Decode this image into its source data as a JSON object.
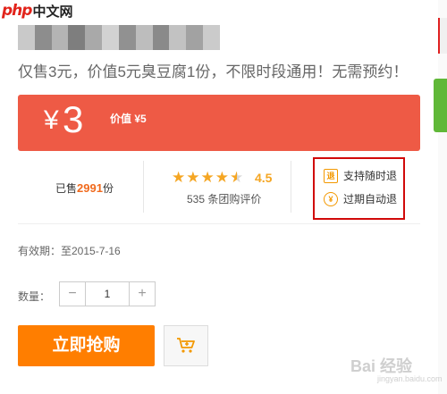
{
  "site_logo": {
    "php": "php",
    "cn": "中文网"
  },
  "deal": {
    "subtitle": "仅售3元，价值5元臭豆腐1份，不限时段通用！无需预约！",
    "price": {
      "yen": "¥",
      "amount": "3",
      "value_label": "价值 ¥5"
    }
  },
  "stats": {
    "sold_prefix": "已售",
    "sold_count": "2991",
    "sold_suffix": "份",
    "rating": {
      "stars": 4.5,
      "score": "4.5"
    },
    "reviews_text": "535 条团购评价"
  },
  "guarantees": [
    {
      "label": "支持随时退",
      "icon": "refund-icon",
      "glyph": "退"
    },
    {
      "label": "过期自动退",
      "icon": "yen-refund-icon",
      "glyph": "¥"
    }
  ],
  "validity": "有效期：至2015-7-16",
  "purchase": {
    "qty_label": "数量：",
    "qty_minus": "−",
    "qty_plus": "+",
    "qty_value": "1",
    "buy_label": "立即抢购",
    "cart_icon": "cart-icon"
  },
  "watermark": {
    "main": "Bai 经验",
    "sub": "jingyan.baidu.com"
  },
  "colors": {
    "price_bar": "#ee5a45",
    "accent_orange": "#ff7e00",
    "star": "#f5a623",
    "highlight_box": "#d10a0a"
  }
}
